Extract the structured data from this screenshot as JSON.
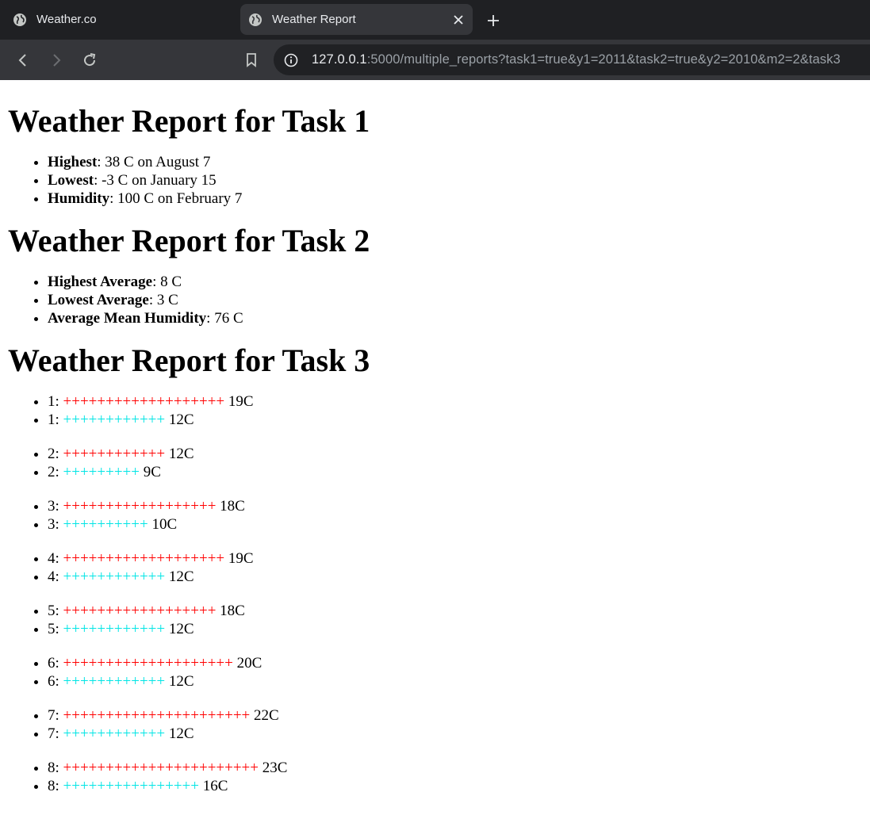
{
  "browser": {
    "tabs": [
      {
        "title": "Weather.co",
        "active": false
      },
      {
        "title": "Weather Report",
        "active": true
      }
    ],
    "url_host": "127.0.0.1",
    "url_path": ":5000/multiple_reports?task1=true&y1=2011&task2=true&y2=2010&m2=2&task3"
  },
  "task1": {
    "heading": "Weather Report for Task 1",
    "items": [
      {
        "label": "Highest",
        "value": ": 38 C on August 7"
      },
      {
        "label": "Lowest",
        "value": ": -3 C on January 15"
      },
      {
        "label": "Humidity",
        "value": ": 100 C on February 7"
      }
    ]
  },
  "task2": {
    "heading": "Weather Report for Task 2",
    "items": [
      {
        "label": "Highest Average",
        "value": ": 8 C"
      },
      {
        "label": "Lowest Average",
        "value": ": 3 C"
      },
      {
        "label": "Average Mean Humidity",
        "value": ": 76 C"
      }
    ]
  },
  "task3": {
    "heading": "Weather Report for Task 3",
    "days": [
      {
        "day": "1",
        "high": 19,
        "high_label": "19C",
        "low": 12,
        "low_label": "12C"
      },
      {
        "day": "2",
        "high": 12,
        "high_label": "12C",
        "low": 9,
        "low_label": "9C"
      },
      {
        "day": "3",
        "high": 18,
        "high_label": "18C",
        "low": 10,
        "low_label": "10C"
      },
      {
        "day": "4",
        "high": 19,
        "high_label": "19C",
        "low": 12,
        "low_label": "12C"
      },
      {
        "day": "5",
        "high": 18,
        "high_label": "18C",
        "low": 12,
        "low_label": "12C"
      },
      {
        "day": "6",
        "high": 20,
        "high_label": "20C",
        "low": 12,
        "low_label": "12C"
      },
      {
        "day": "7",
        "high": 22,
        "high_label": "22C",
        "low": 12,
        "low_label": "12C"
      },
      {
        "day": "8",
        "high": 23,
        "high_label": "23C",
        "low": 16,
        "low_label": "16C"
      }
    ],
    "high_color": "#ff0000",
    "low_color": "#00e5e5"
  }
}
